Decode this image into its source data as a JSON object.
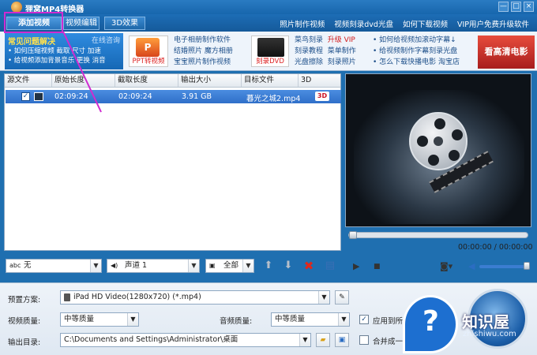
{
  "window": {
    "title": "狸窝MP4转换器",
    "controls": [
      "—",
      "□",
      "×"
    ]
  },
  "toolbar": {
    "add_video": "添加视频",
    "edit_video": "视频编辑",
    "effect_3d": "3D效果",
    "links": [
      "照片制作视频",
      "视频刻录dvd光盘",
      "如何下载视频",
      "VIP用户免费升级软件"
    ]
  },
  "promo": {
    "faq_title": "常见问题解决",
    "faq_online": "在线咨询",
    "faq_lines": [
      "• 如何压缩视频 截取 尺寸 加速",
      "• 给视频添加背景音乐 更换 消音"
    ],
    "ppt_caption": "PPT转视频",
    "ppt_badge": "P",
    "col1": [
      "电子相册制作软件",
      "结婚照片 魔方相册",
      "宝宝照片制作视频"
    ],
    "dvd_caption": "刻录DVD",
    "col2": [
      {
        "a": "菜鸟刻录",
        "b": "升级 VIP"
      },
      {
        "a": "刻录教程",
        "b": "菜单制作"
      },
      {
        "a": "光盘擦除",
        "b": "刻录照片"
      }
    ],
    "col3": [
      "• 如何给视频加滚动字幕↓",
      "• 给视频制作字幕刻录光盘",
      "• 怎么下载快播电影  淘宝店"
    ],
    "hd_banner": "看高清电影"
  },
  "table": {
    "headers": [
      "源文件",
      "原始长度",
      "截取长度",
      "输出大小",
      "目标文件",
      "3D"
    ],
    "rows": [
      {
        "original": "02:09:24",
        "cut": "02:09:24",
        "size": "3.91 GB",
        "target": "暮光之城2.mp4",
        "badge": "3D"
      }
    ]
  },
  "controls": {
    "subtitle": "无",
    "audio": "声道 1",
    "selection": "全部"
  },
  "player": {
    "time": "00:00:00 / 00:00:00",
    "progress": 0,
    "volume": 1.0
  },
  "settings": {
    "preset_label": "预置方案:",
    "preset_value": "iPad HD Video(1280x720) (*.mp4)",
    "video_quality_label": "视频质量:",
    "video_quality": "中等质量",
    "audio_quality_label": "音频质量:",
    "audio_quality": "中等质量",
    "apply_all": "应用到所",
    "output_label": "输出目录:",
    "output_path": "C:\\Documents and Settings\\Administrator\\桌面",
    "merge": "合并成一"
  },
  "watermark": {
    "title": "知识屋",
    "url": "zhishiwu.com"
  },
  "colors": {
    "accent": "#1f6fb0",
    "highlight": "#d02bd0",
    "selected_row": "#3b7dd4"
  }
}
